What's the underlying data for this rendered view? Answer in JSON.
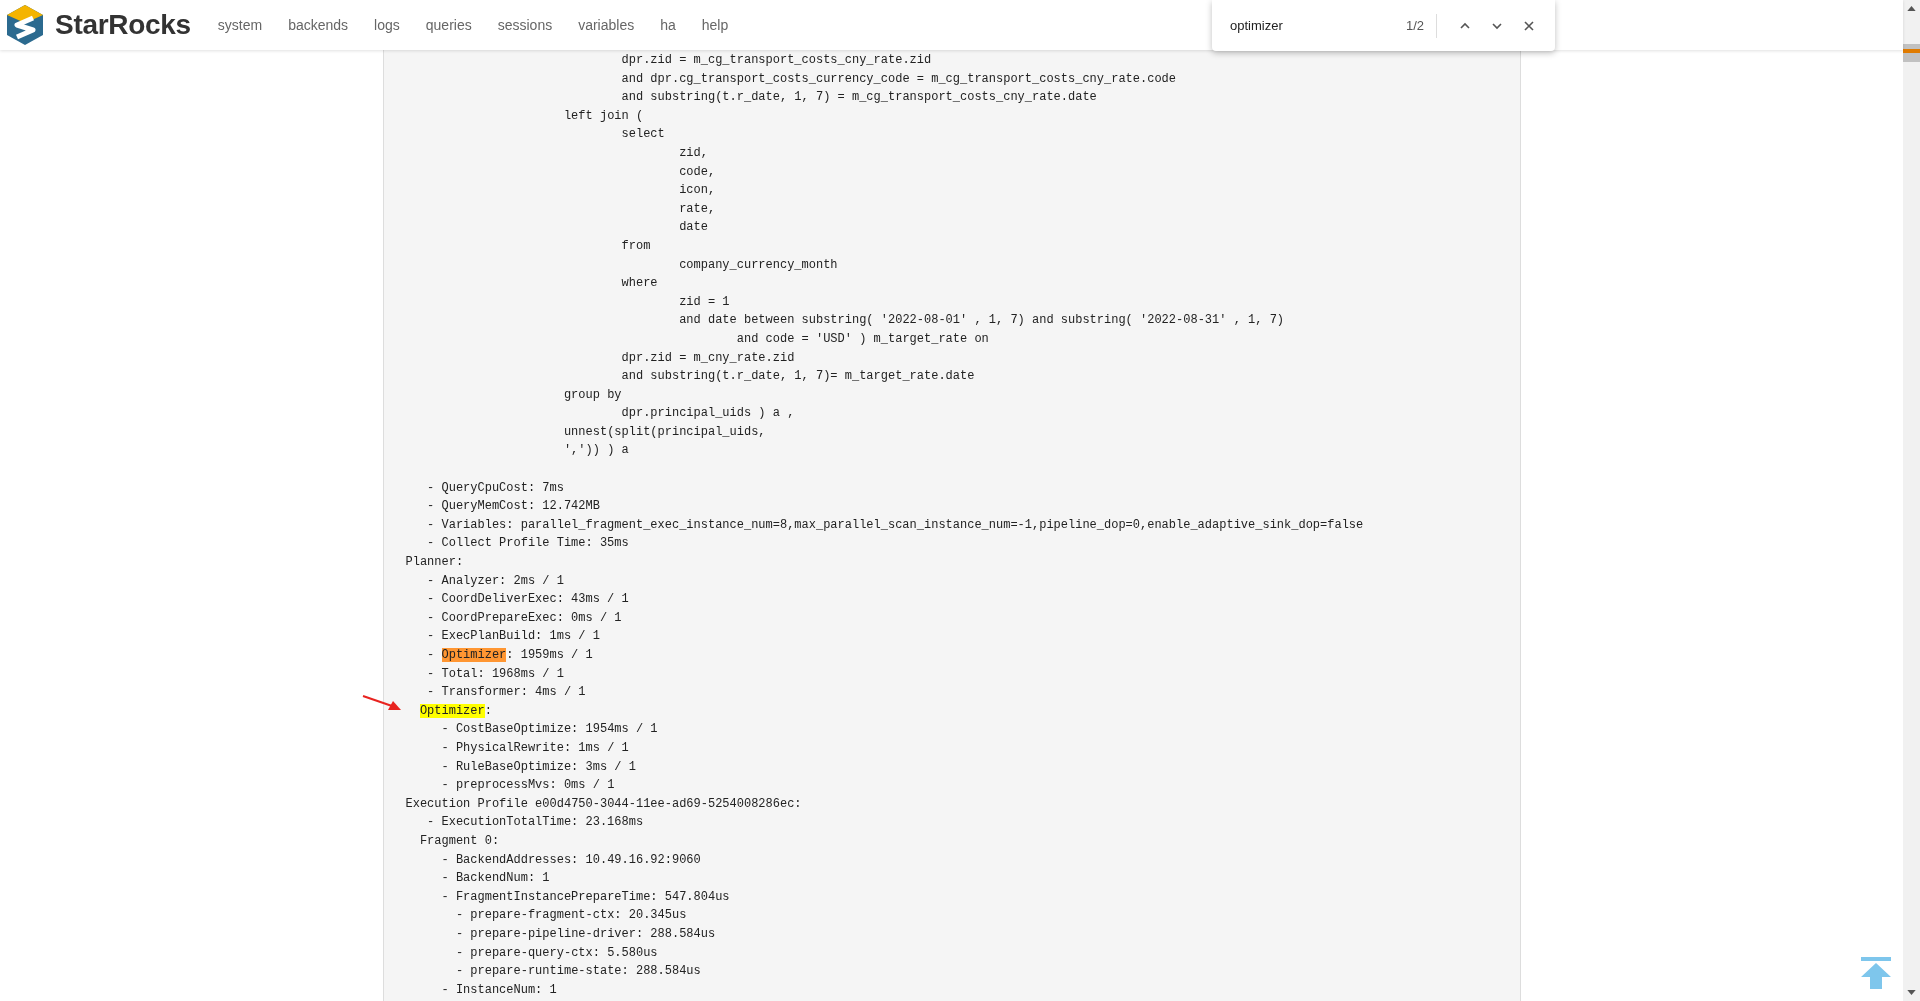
{
  "header": {
    "brand": "StarRocks",
    "nav": [
      {
        "label": "system"
      },
      {
        "label": "backends"
      },
      {
        "label": "logs"
      },
      {
        "label": "queries"
      },
      {
        "label": "sessions"
      },
      {
        "label": "variables"
      },
      {
        "label": "ha"
      },
      {
        "label": "help"
      }
    ]
  },
  "find_bar": {
    "value": "optimizer",
    "count": "1/2"
  },
  "query_tail": [
    "                              dpr.zid = m_cg_transport_costs_cny_rate.zid",
    "                              and dpr.cg_transport_costs_currency_code = m_cg_transport_costs_cny_rate.code",
    "                              and substring(t.r_date, 1, 7) = m_cg_transport_costs_cny_rate.date",
    "                      left join (",
    "                              select",
    "                                      zid,",
    "                                      code,",
    "                                      icon,",
    "                                      rate,",
    "                                      date",
    "                              from",
    "                                      company_currency_month",
    "                              where",
    "                                      zid = 1",
    "                                      and date between substring( '2022-08-01' , 1, 7) and substring( '2022-08-31' , 1, 7)",
    "                                              and code = 'USD' ) m_target_rate on",
    "                              dpr.zid = m_cny_rate.zid",
    "                              and substring(t.r_date, 1, 7)= m_target_rate.date",
    "                      group by",
    "                              dpr.principal_uids ) a ,",
    "                      unnest(split(principal_uids,",
    "                      ',')) ) a"
  ],
  "profile": [
    "   - QueryCpuCost: 7ms",
    "   - QueryMemCost: 12.742MB",
    "   - Variables: parallel_fragment_exec_instance_num=8,max_parallel_scan_instance_num=-1,pipeline_dop=0,enable_adaptive_sink_dop=false",
    "   - Collect Profile Time: 35ms",
    "Planner:",
    "   - Analyzer: 2ms / 1",
    "   - CoordDeliverExec: 43ms / 1",
    "   - CoordPrepareExec: 0ms / 1",
    "   - ExecPlanBuild: 1ms / 1",
    {
      "before": "   - ",
      "match": "Optimizer",
      "selected": true,
      "after": ": 1959ms / 1"
    },
    "   - Total: 1968ms / 1",
    "   - Transformer: 4ms / 1",
    {
      "match": "Optimizer",
      "selected": false,
      "after": ":"
    },
    "     - CostBaseOptimize: 1954ms / 1",
    "     - PhysicalRewrite: 1ms / 1",
    "     - RuleBaseOptimize: 3ms / 1",
    "     - preprocessMvs: 0ms / 1",
    "Execution Profile e00d4750-3044-11ee-ad69-5254008286ec:",
    "   - ExecutionTotalTime: 23.168ms",
    "  Fragment 0:",
    "     - BackendAddresses: 10.49.16.92:9060",
    "     - BackendNum: 1",
    "     - FragmentInstancePrepareTime: 547.804us",
    "       - prepare-fragment-ctx: 20.345us",
    "       - prepare-pipeline-driver: 288.584us",
    "       - prepare-query-ctx: 5.580us",
    "       - prepare-runtime-state: 288.584us",
    "     - InstanceNum: 1"
  ]
}
